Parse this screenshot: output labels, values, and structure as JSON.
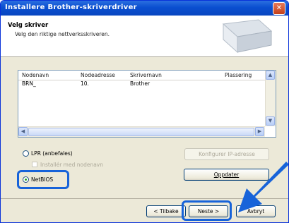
{
  "window": {
    "title": "Installere Brother-skriverdriver",
    "close_label": "✕"
  },
  "header": {
    "title": "Velg skriver",
    "subtitle": "Velg den riktige nettverksskriveren."
  },
  "list": {
    "columns": [
      "Nodenavn",
      "Nodeadresse",
      "Skrivernavn",
      "Plassering"
    ],
    "rows": [
      [
        "BRN_",
        "10.",
        "Brother",
        ""
      ]
    ]
  },
  "options": {
    "lpr_label": "LPR (anbefales)",
    "lpr_selected": false,
    "install_by_node_label": "Installér med nodenavn",
    "netbios_label": "NetBIOS",
    "netbios_selected": true
  },
  "buttons": {
    "configure_ip": "Konfigurer IP-adresse",
    "update": "Oppdater",
    "back": "< Tilbake",
    "next": "Neste >",
    "cancel": "Avbryt"
  },
  "colors": {
    "highlight": "#1763d9",
    "titlebar": "#0a4fd0"
  }
}
